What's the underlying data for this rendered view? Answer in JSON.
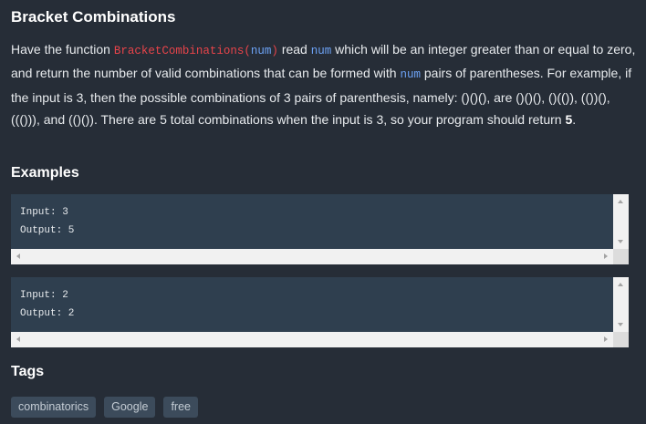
{
  "title": "Bracket Combinations",
  "description": {
    "t1": "Have the function ",
    "fn_name": "BracketCombinations",
    "paren_open": "(",
    "arg": "num",
    "paren_close": ")",
    "t2": " read ",
    "arg2": "num",
    "t3": " which will be an integer greater than or equal to zero, and return the number of valid combinations that can be formed with ",
    "arg3": "num",
    "t4": " pairs of parentheses. For example, if the input is 3, then the possible combinations of 3 pairs of parenthesis, namely: ()()(), are ()()(), ()(()), (())(), ((())), and (()()). There are 5 total combinations when the input is 3, so your program should return ",
    "answer": "5",
    "t5": "."
  },
  "examples_heading": "Examples",
  "examples": [
    {
      "input": "Input: 3",
      "output": "Output: 5"
    },
    {
      "input": "Input: 2",
      "output": "Output: 2"
    }
  ],
  "tags_heading": "Tags",
  "tags": [
    "combinatorics",
    "Google",
    "free"
  ],
  "colors": {
    "background": "#262d37",
    "code_box": "#2f3f4f",
    "function_name": "#e8444a",
    "argument": "#6da3f6",
    "tag_background": "#3c4b5b"
  }
}
